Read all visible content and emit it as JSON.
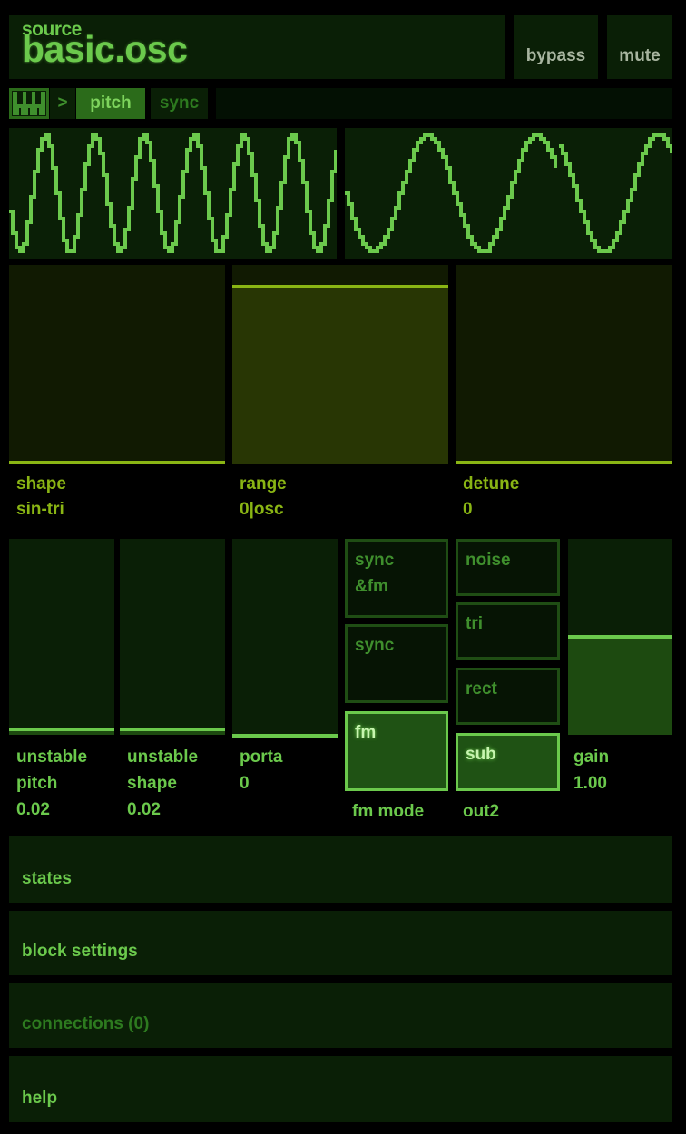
{
  "header": {
    "category": "source",
    "title": "basic.osc",
    "bypass_label": "bypass",
    "mute_label": "mute"
  },
  "breadcrumb": {
    "icon": "keyboard-icon",
    "separator": ">",
    "tabs": [
      {
        "label": "pitch",
        "active": true
      },
      {
        "label": "sync",
        "active": false
      }
    ]
  },
  "scopes": [
    {
      "name": "oscillator-scope-left",
      "cycles": 6.6,
      "waveform": "sin-tri stepped"
    },
    {
      "name": "oscillator-scope-right",
      "cycles": 3.0,
      "waveform": "sine stepped, sync reset"
    }
  ],
  "top_controls": [
    {
      "name": "shape",
      "label": "shape",
      "value": "sin-tri",
      "level": 0.0
    },
    {
      "name": "range",
      "label": "range",
      "value": "0|osc",
      "level": 0.9
    },
    {
      "name": "detune",
      "label": "detune",
      "value": "0",
      "level": 0.0
    }
  ],
  "bottom_controls": {
    "unstable_pitch": {
      "label_1": "unstable",
      "label_2": "pitch",
      "value": "0.02",
      "level": 0.02
    },
    "unstable_shape": {
      "label_1": "unstable",
      "label_2": "shape",
      "value": "0.02",
      "level": 0.02
    },
    "porta": {
      "label": "porta",
      "value": "0",
      "level": 0.0
    },
    "fm_mode": {
      "label": "fm mode",
      "options": [
        {
          "line_1": "sync",
          "line_2": "&fm",
          "selected": false
        },
        {
          "line_1": "sync",
          "line_2": "",
          "selected": false
        },
        {
          "line_1": "fm",
          "line_2": "",
          "selected": true
        }
      ]
    },
    "out2": {
      "label": "out2",
      "options": [
        {
          "label": "noise",
          "selected": false
        },
        {
          "label": "tri",
          "selected": false
        },
        {
          "label": "rect",
          "selected": false
        },
        {
          "label": "sub",
          "selected": true
        }
      ]
    },
    "gain": {
      "label": "gain",
      "value": "1.00",
      "level": 0.5
    }
  },
  "sections": [
    {
      "label": "states",
      "enabled": true
    },
    {
      "label": "block settings",
      "enabled": true
    },
    {
      "label": "connections (0)",
      "enabled": false
    },
    {
      "label": "help",
      "enabled": true
    }
  ],
  "colors": {
    "accent_green": "#6bc94c",
    "accent_yellow": "#8ab514",
    "panel": "#0a1f06"
  }
}
